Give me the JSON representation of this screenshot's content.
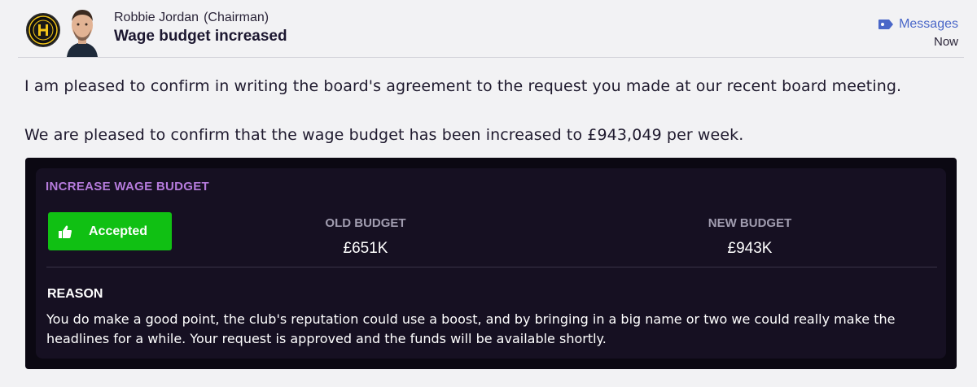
{
  "header": {
    "sender_name": "Robbie Jordan",
    "sender_role": "(Chairman)",
    "subject": "Wage budget increased",
    "messages_link": "Messages",
    "time": "Now"
  },
  "body": {
    "paragraph1": "I am pleased to confirm in writing the board's agreement to the request you made at our recent board meeting.",
    "paragraph2": "We are pleased to confirm that the wage budget has been increased to £943,049 per week."
  },
  "panel": {
    "title": "INCREASE WAGE BUDGET",
    "status_button": "Accepted",
    "old_label": "OLD BUDGET",
    "old_value": "£651K",
    "new_label": "NEW BUDGET",
    "new_value": "£943K",
    "reason_title": "REASON",
    "reason_text": "You do make a good point, the club's reputation could use a boost, and by bringing in a big name or two we could really make the headlines for a while. Your request is approved and the funds will be available shortly."
  },
  "colors": {
    "accent_link": "#4a67c8",
    "panel_title": "#b57bdc",
    "accepted_green": "#10c013",
    "panel_bg": "#161022"
  },
  "icons": {
    "club_badge": "club-crest-icon",
    "messages": "tag-icon",
    "accepted": "thumbs-up-icon"
  }
}
